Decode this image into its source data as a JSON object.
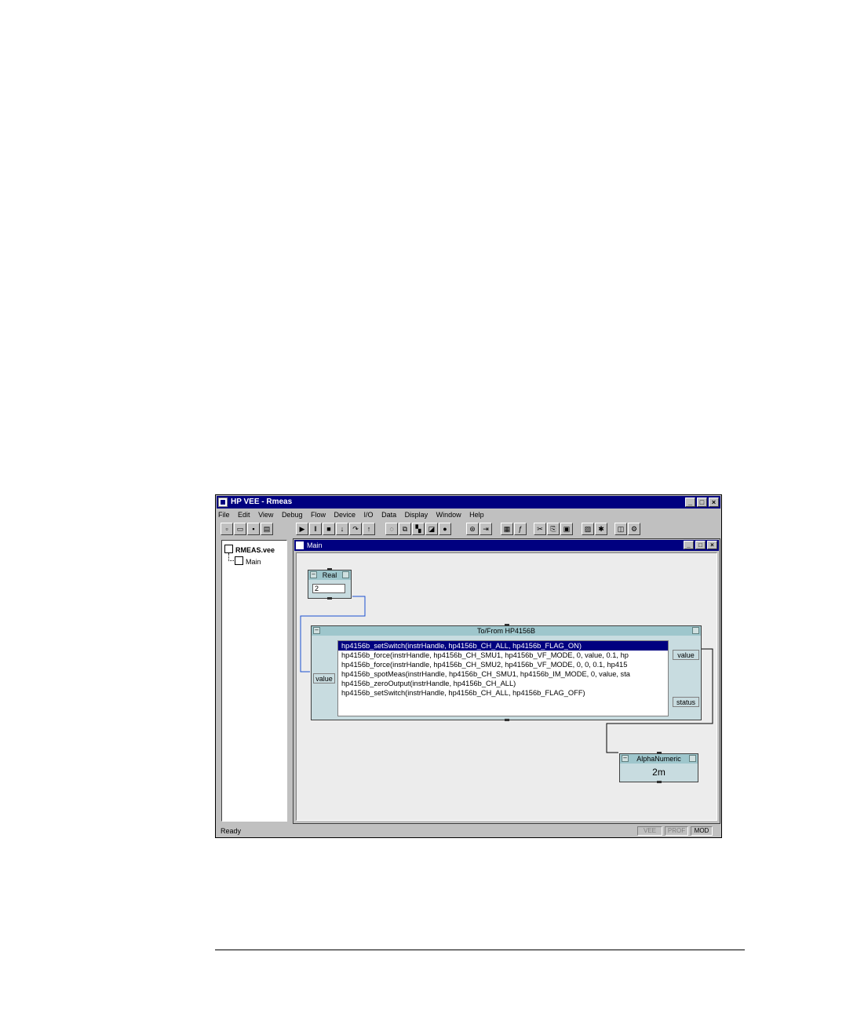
{
  "app": {
    "title": "HP VEE - Rmeas",
    "window_buttons": [
      "_",
      "□",
      "×"
    ]
  },
  "menu": [
    "File",
    "Edit",
    "View",
    "Debug",
    "Flow",
    "Device",
    "I/O",
    "Data",
    "Display",
    "Window",
    "Help"
  ],
  "toolbar_icons": [
    "new-icon",
    "open-icon",
    "save-icon",
    "print-icon",
    "run-icon",
    "pause-icon",
    "stop-icon",
    "step-into-icon",
    "step-over-icon",
    "step-out-icon",
    "show-data-flow-icon",
    "show-exec-flow-icon",
    "line-probe-icon",
    "breakpoint-icon",
    "clear-breakpoints-icon",
    "find-icon",
    "go-to-icon",
    "instrument-manager-icon",
    "function-icon",
    "cut-icon",
    "copy-icon",
    "paste-icon",
    "create-panel-icon",
    "properties-icon",
    "panel-view-icon",
    "options-icon"
  ],
  "tree": {
    "root": "RMEAS.vee",
    "child": "Main"
  },
  "main_window": {
    "title": "Main"
  },
  "objects": {
    "real": {
      "title": "Real",
      "value": "2"
    },
    "tofrom": {
      "title": "To/From HP4156B",
      "input_pin": "value",
      "output_pins": [
        "value",
        "status"
      ],
      "lines": [
        "hp4156b_setSwitch(instrHandle, hp4156b_CH_ALL, hp4156b_FLAG_ON)",
        "hp4156b_force(instrHandle, hp4156b_CH_SMU1, hp4156b_VF_MODE, 0, value, 0.1, hp",
        "hp4156b_force(instrHandle, hp4156b_CH_SMU2, hp4156b_VF_MODE, 0, 0, 0.1, hp415",
        "hp4156b_spotMeas(instrHandle, hp4156b_CH_SMU1, hp4156b_IM_MODE, 0, value, sta",
        "hp4156b_zeroOutput(instrHandle, hp4156b_CH_ALL)",
        "hp4156b_setSwitch(instrHandle, hp4156b_CH_ALL, hp4156b_FLAG_OFF)"
      ],
      "selected_line": 0
    },
    "alphanumeric": {
      "title": "AlphaNumeric",
      "value": "2m"
    }
  },
  "statusbar": {
    "text": "Ready",
    "indicators": [
      "VEE",
      "PROF",
      "MOD"
    ]
  },
  "colors": {
    "titlebar": "#000080",
    "object_header": "#9ec6cc",
    "object_body": "#c8dce0",
    "wire": "#1a4fd0"
  }
}
